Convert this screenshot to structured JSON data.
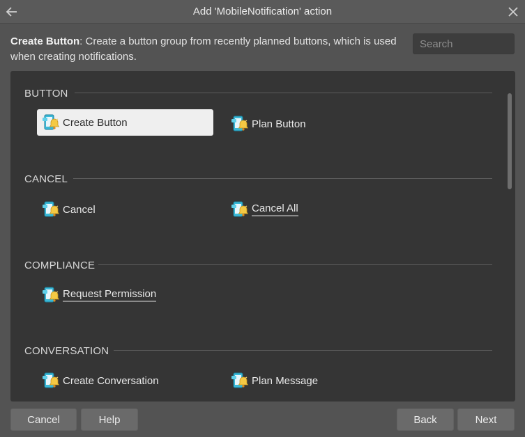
{
  "window": {
    "title": "Add 'MobileNotification' action",
    "back_icon": "arrow-left-icon",
    "close_icon": "close-icon"
  },
  "description": {
    "bold": "Create Button",
    "text": ": Create a button group from recently planned buttons, which is used when creating notifications."
  },
  "search": {
    "placeholder": "Search",
    "value": ""
  },
  "sections": [
    {
      "header": "BUTTON",
      "items": [
        {
          "label": "Create Button",
          "icon": "mobile-notification-icon",
          "selected": true
        },
        {
          "label": "Plan Button",
          "icon": "mobile-notification-icon"
        }
      ]
    },
    {
      "header": "CANCEL",
      "items": [
        {
          "label": "Cancel",
          "icon": "mobile-notification-icon"
        },
        {
          "label": "Cancel All",
          "icon": "mobile-notification-icon",
          "underlined": true
        }
      ]
    },
    {
      "header": "COMPLIANCE",
      "items": [
        {
          "label": "Request Permission",
          "icon": "mobile-notification-icon",
          "underlined": true
        }
      ]
    },
    {
      "header": "CONVERSATION",
      "items": [
        {
          "label": "Create Conversation",
          "icon": "mobile-notification-icon"
        },
        {
          "label": "Plan Message",
          "icon": "mobile-notification-icon"
        }
      ]
    }
  ],
  "footer": {
    "cancel": "Cancel",
    "help": "Help",
    "back": "Back",
    "next": "Next"
  },
  "colors": {
    "background": "#535353",
    "panel": "#353535",
    "selected_item": "#efefef",
    "button": "#6a6a6a",
    "icon_cyan": "#39c2e0",
    "icon_yellow": "#f2c84b"
  }
}
